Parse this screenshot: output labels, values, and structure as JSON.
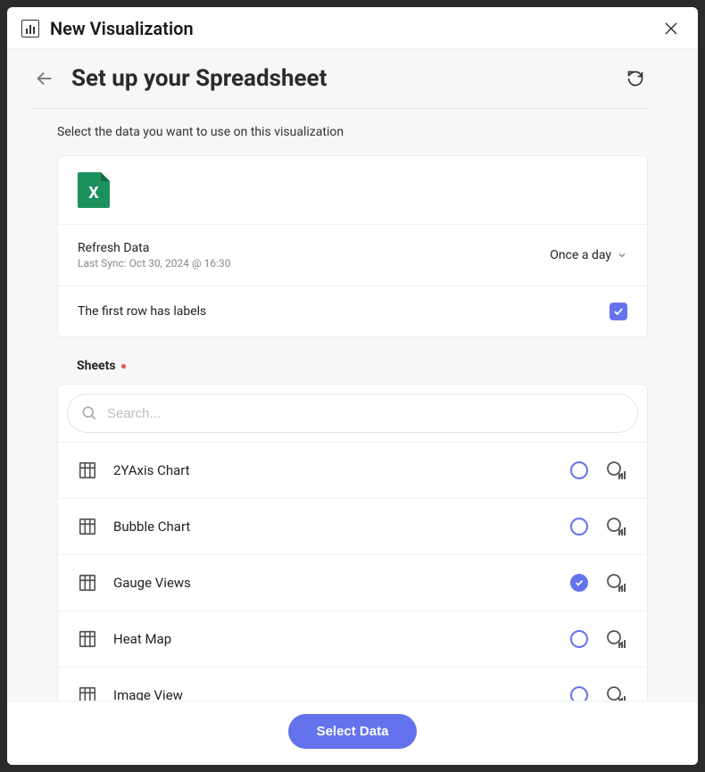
{
  "modal": {
    "title": "New Visualization"
  },
  "page": {
    "heading": "Set up your Spreadsheet",
    "instructions": "Select the data you want to use on this visualization"
  },
  "source": {
    "refresh_label": "Refresh Data",
    "last_sync": "Last Sync: Oct 30, 2024 @ 16:30",
    "frequency": "Once a day",
    "labels_row_text": "The first row has labels",
    "labels_checked": true
  },
  "sheets": {
    "section_label": "Sheets",
    "search_placeholder": "Search...",
    "items": [
      {
        "name": "2YAxis Chart",
        "selected": false
      },
      {
        "name": "Bubble Chart",
        "selected": false
      },
      {
        "name": "Gauge Views",
        "selected": true
      },
      {
        "name": "Heat Map",
        "selected": false
      },
      {
        "name": "Image View",
        "selected": false
      }
    ]
  },
  "footer": {
    "select_label": "Select Data"
  }
}
